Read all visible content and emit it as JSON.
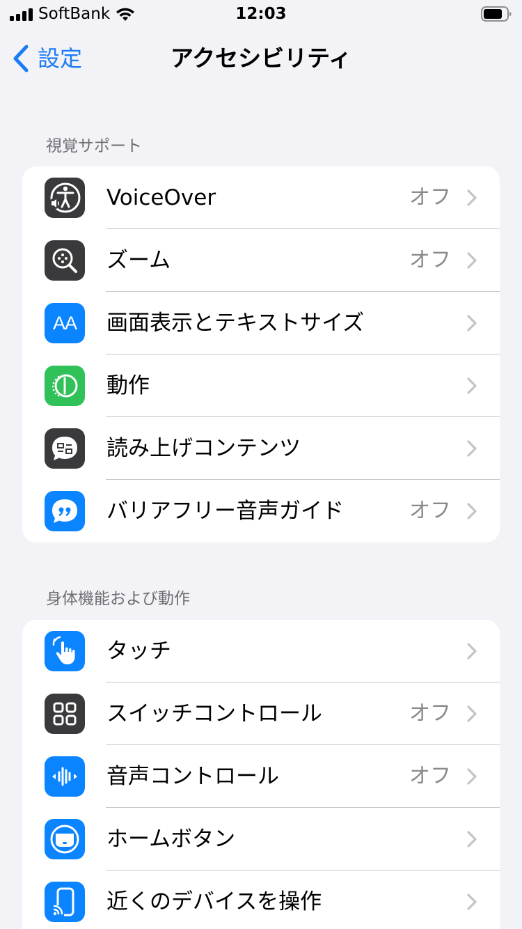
{
  "status_bar": {
    "carrier": "SoftBank",
    "time": "12:03"
  },
  "nav": {
    "back_label": "設定",
    "title": "アクセシビリティ"
  },
  "sections": [
    {
      "header": "視覚サポート",
      "rows": [
        {
          "label": "VoiceOver",
          "value": "オフ",
          "icon": "voiceover-icon",
          "color": "#3a3a3c"
        },
        {
          "label": "ズーム",
          "value": "オフ",
          "icon": "zoom-icon",
          "color": "#3a3a3c"
        },
        {
          "label": "画面表示とテキストサイズ",
          "value": "",
          "icon": "text-size-icon",
          "color": "#0a84ff",
          "glyph": "AA"
        },
        {
          "label": "動作",
          "value": "",
          "icon": "motion-icon",
          "color": "#30c158"
        },
        {
          "label": "読み上げコンテンツ",
          "value": "",
          "icon": "spoken-content-icon",
          "color": "#3a3a3c"
        },
        {
          "label": "バリアフリー音声ガイド",
          "value": "オフ",
          "icon": "audio-descriptions-icon",
          "color": "#0a84ff"
        }
      ]
    },
    {
      "header": "身体機能および動作",
      "rows": [
        {
          "label": "タッチ",
          "value": "",
          "icon": "touch-icon",
          "color": "#0a84ff"
        },
        {
          "label": "スイッチコントロール",
          "value": "オフ",
          "icon": "switch-control-icon",
          "color": "#3a3a3c"
        },
        {
          "label": "音声コントロール",
          "value": "オフ",
          "icon": "voice-control-icon",
          "color": "#0a84ff"
        },
        {
          "label": "ホームボタン",
          "value": "",
          "icon": "home-button-icon",
          "color": "#0a84ff"
        },
        {
          "label": "近くのデバイスを操作",
          "value": "",
          "icon": "nearby-devices-icon",
          "color": "#0a84ff"
        }
      ]
    }
  ]
}
